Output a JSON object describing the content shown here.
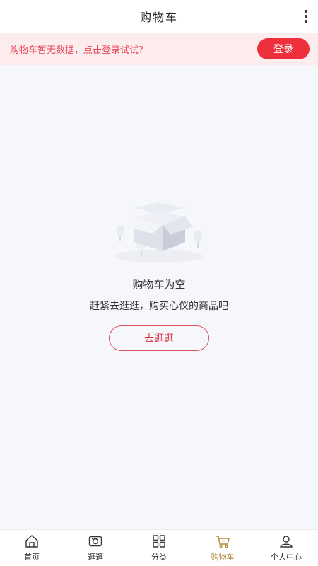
{
  "header": {
    "title": "购物车"
  },
  "login_bar": {
    "tip": "购物车暂无数据，点击登录试试?",
    "button_label": "登录"
  },
  "empty_state": {
    "title": "购物车为空",
    "subtitle": "赶紧去逛逛，购买心仪的商品吧",
    "button_label": "去逛逛"
  },
  "tabbar": {
    "active_index": 3,
    "active_color": "#b48a3c",
    "items": [
      {
        "label": "首页",
        "icon": "home-icon"
      },
      {
        "label": "逛逛",
        "icon": "browse-icon"
      },
      {
        "label": "分类",
        "icon": "category-icon"
      },
      {
        "label": "购物车",
        "icon": "cart-icon"
      },
      {
        "label": "个人中心",
        "icon": "profile-icon"
      }
    ]
  },
  "colors": {
    "accent": "#ee2f3c",
    "banner_bg": "#fdecee",
    "page_bg": "#f6f7fb"
  }
}
